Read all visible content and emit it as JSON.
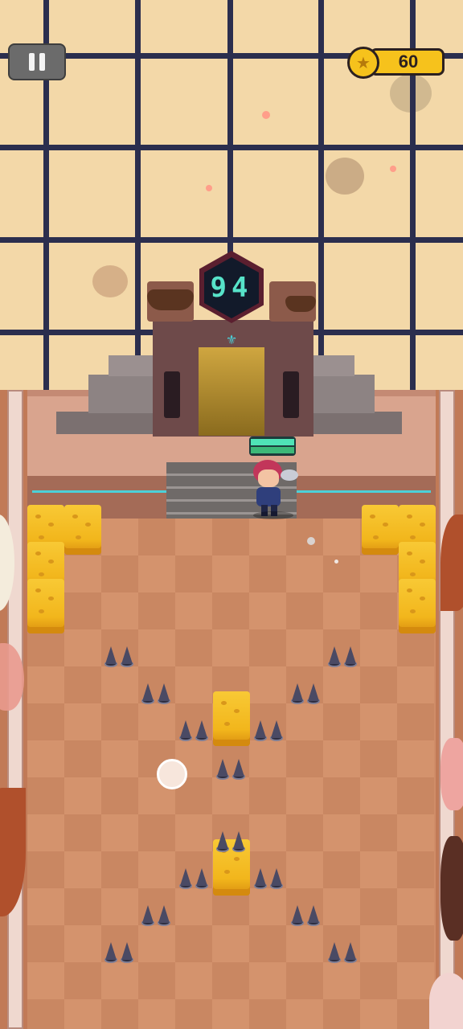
{
  "hud": {
    "pause_icon": "pause-icon",
    "coin_icon": "star-coin-icon",
    "coin_count": "60"
  },
  "level": {
    "number": "94"
  },
  "player": {
    "health_fraction": 1.0
  },
  "colors": {
    "window_bg": "#f3d8a8",
    "window_bars": "#2b2e4e",
    "floor": "#d08d68",
    "cheese": "#f2b61c",
    "coin": "#f6c21c",
    "level_digits": "#57e3c9",
    "health": "#4fe3b6"
  }
}
